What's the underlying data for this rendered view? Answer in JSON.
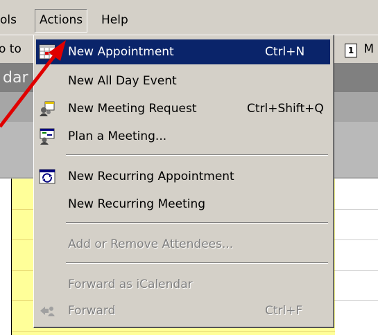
{
  "menubar": {
    "tools_label": "ols",
    "actions_label": "Actions",
    "help_label": "Help"
  },
  "toolbar": {
    "goto_label": "o to",
    "right_icon_label": "1",
    "right_label": "M"
  },
  "titleband": {
    "text": "dar"
  },
  "menu": {
    "new_appointment": {
      "label": "New Appointment",
      "shortcut": "Ctrl+N"
    },
    "new_all_day_event": {
      "label": "New All Day Event"
    },
    "new_meeting_request": {
      "label": "New Meeting Request",
      "shortcut": "Ctrl+Shift+Q"
    },
    "plan_a_meeting": {
      "label": "Plan a Meeting..."
    },
    "new_recurring_appointment": {
      "label": "New Recurring Appointment"
    },
    "new_recurring_meeting": {
      "label": "New Recurring Meeting"
    },
    "add_remove_attendees": {
      "label": "Add or Remove Attendees..."
    },
    "forward_icalendar": {
      "label": "Forward as iCalendar"
    },
    "forward": {
      "label": "Forward",
      "shortcut": "Ctrl+F"
    }
  },
  "colors": {
    "highlight": "#0a246a",
    "menu_bg": "#d4d0c8",
    "calendar_bg": "#ffff99",
    "arrow": "#e00000"
  }
}
